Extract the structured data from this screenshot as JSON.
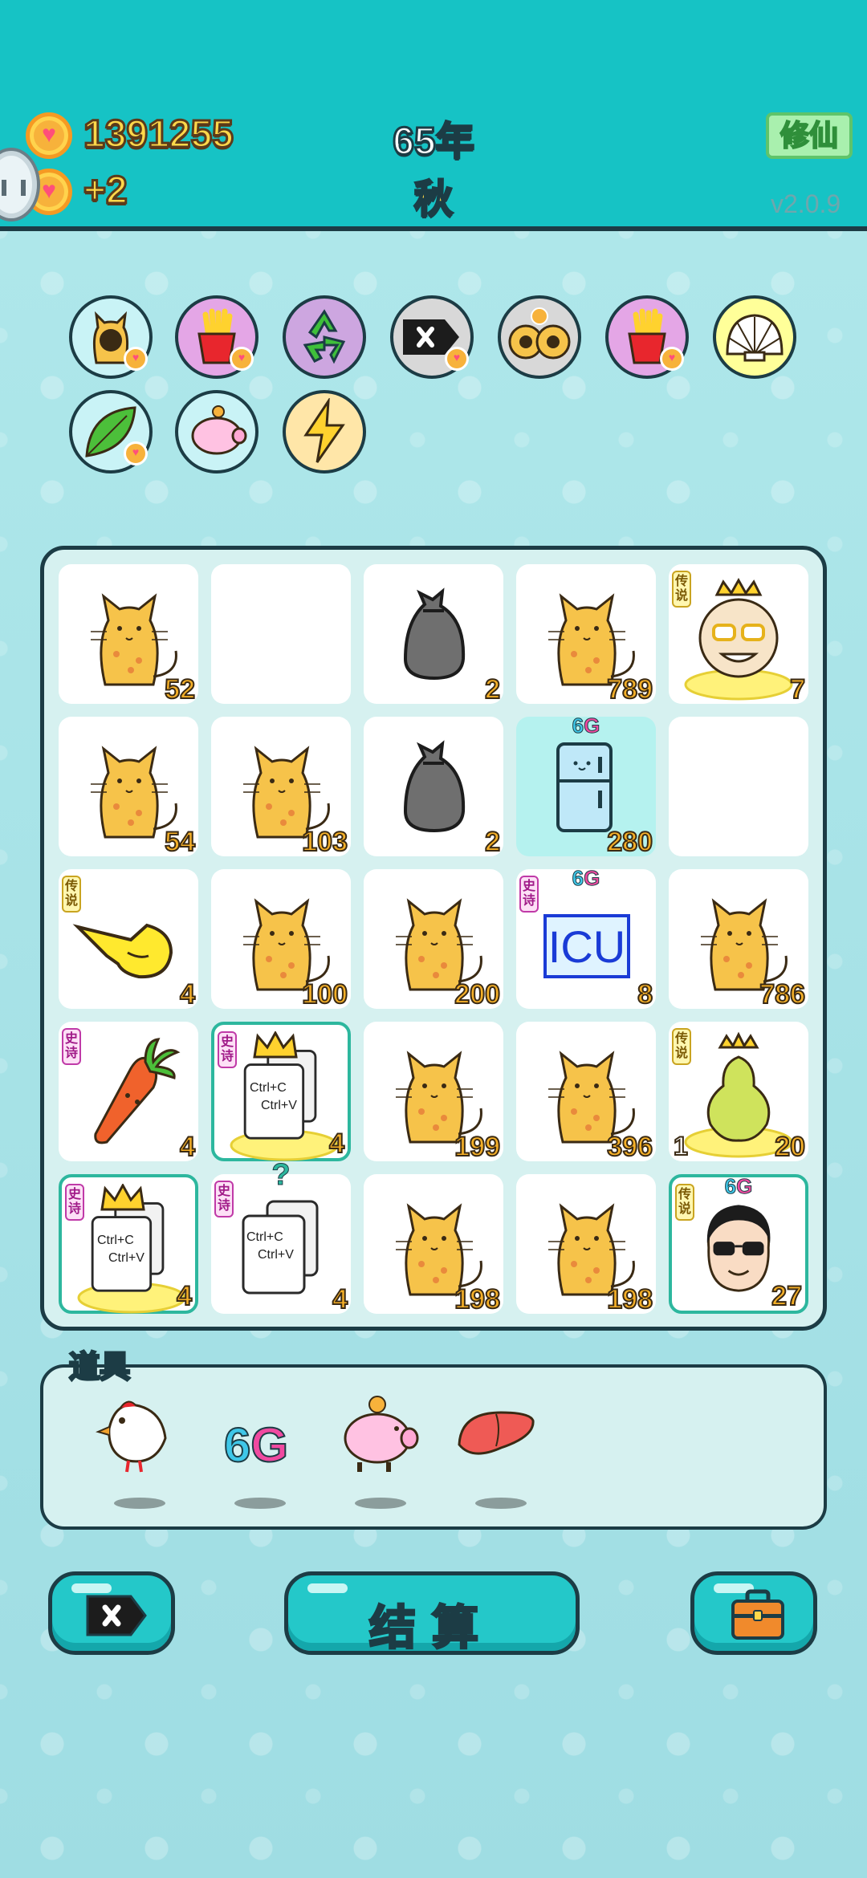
{
  "header": {
    "coins": "1391255",
    "income": "+2",
    "year": "65年",
    "season": "秋",
    "cultivate_label": "修仙",
    "version": "v2.0.9"
  },
  "symbols": [
    {
      "name": "cat-coin-icon",
      "bg": "#c9f3f6"
    },
    {
      "name": "fries-icon",
      "bg": "#e4a6e6"
    },
    {
      "name": "recycle-icon",
      "bg": "#cda6e0"
    },
    {
      "name": "remove-tag-icon",
      "bg": "#d8d8d8"
    },
    {
      "name": "cat-coins-icon",
      "bg": "#d8d8d8"
    },
    {
      "name": "fries-icon",
      "bg": "#e4a6e6"
    },
    {
      "name": "shell-icon",
      "bg": "#ffff99"
    },
    {
      "name": "leaf-icon",
      "bg": "#c9f3f6"
    },
    {
      "name": "piggy-icon",
      "bg": "#c9f3f6"
    },
    {
      "name": "lightning-icon",
      "bg": "#ffe6a8"
    }
  ],
  "board": {
    "rows": [
      [
        {
          "type": "cat",
          "count": "52"
        },
        {
          "type": "empty"
        },
        {
          "type": "bag",
          "count": "2"
        },
        {
          "type": "cat",
          "count": "789"
        },
        {
          "type": "king",
          "count": "7",
          "tag": "传说"
        }
      ],
      [
        {
          "type": "cat",
          "count": "54"
        },
        {
          "type": "cat",
          "count": "103"
        },
        {
          "type": "bag",
          "count": "2"
        },
        {
          "type": "fridge",
          "count": "280",
          "badge": "6G",
          "highlight": true
        },
        {
          "type": "empty"
        }
      ],
      [
        {
          "type": "hand",
          "count": "4",
          "tag": "传说"
        },
        {
          "type": "cat",
          "count": "100"
        },
        {
          "type": "cat",
          "count": "200"
        },
        {
          "type": "icu",
          "count": "8",
          "tag": "史诗",
          "badge": "6G",
          "text": "ICU"
        },
        {
          "type": "cat",
          "count": "786"
        }
      ],
      [
        {
          "type": "carrot",
          "count": "4",
          "tag": "史诗"
        },
        {
          "type": "copy",
          "count": "4",
          "tag": "史诗",
          "crown": true,
          "framed": true,
          "line1": "Ctrl+C",
          "line2": "Ctrl+V"
        },
        {
          "type": "cat",
          "count": "199"
        },
        {
          "type": "cat",
          "count": "396"
        },
        {
          "type": "pear",
          "count": "20",
          "tag": "传说",
          "extra": "1"
        }
      ],
      [
        {
          "type": "copy",
          "count": "4",
          "tag": "史诗",
          "crown": true,
          "framed": true,
          "line1": "Ctrl+C",
          "line2": "Ctrl+V"
        },
        {
          "type": "copy",
          "count": "4",
          "tag": "史诗",
          "question": "?",
          "line1": "Ctrl+C",
          "line2": "Ctrl+V"
        },
        {
          "type": "cat",
          "count": "198"
        },
        {
          "type": "cat",
          "count": "198"
        },
        {
          "type": "face",
          "count": "27",
          "tag": "传说",
          "badge": "6G",
          "framed": true
        }
      ]
    ]
  },
  "items": {
    "title": "道具",
    "list": [
      {
        "name": "bird-icon"
      },
      {
        "name": "6g-icon",
        "text": "6G"
      },
      {
        "name": "piggy-bank-icon"
      },
      {
        "name": "liver-icon"
      }
    ]
  },
  "buttons": {
    "settle_label": "结算"
  },
  "colors": {
    "topbar": "#16c3c5",
    "coin_text": "#ffd84a",
    "count_text": "#f5b028",
    "button": "#24c8c9",
    "outline": "#1c3c45"
  }
}
